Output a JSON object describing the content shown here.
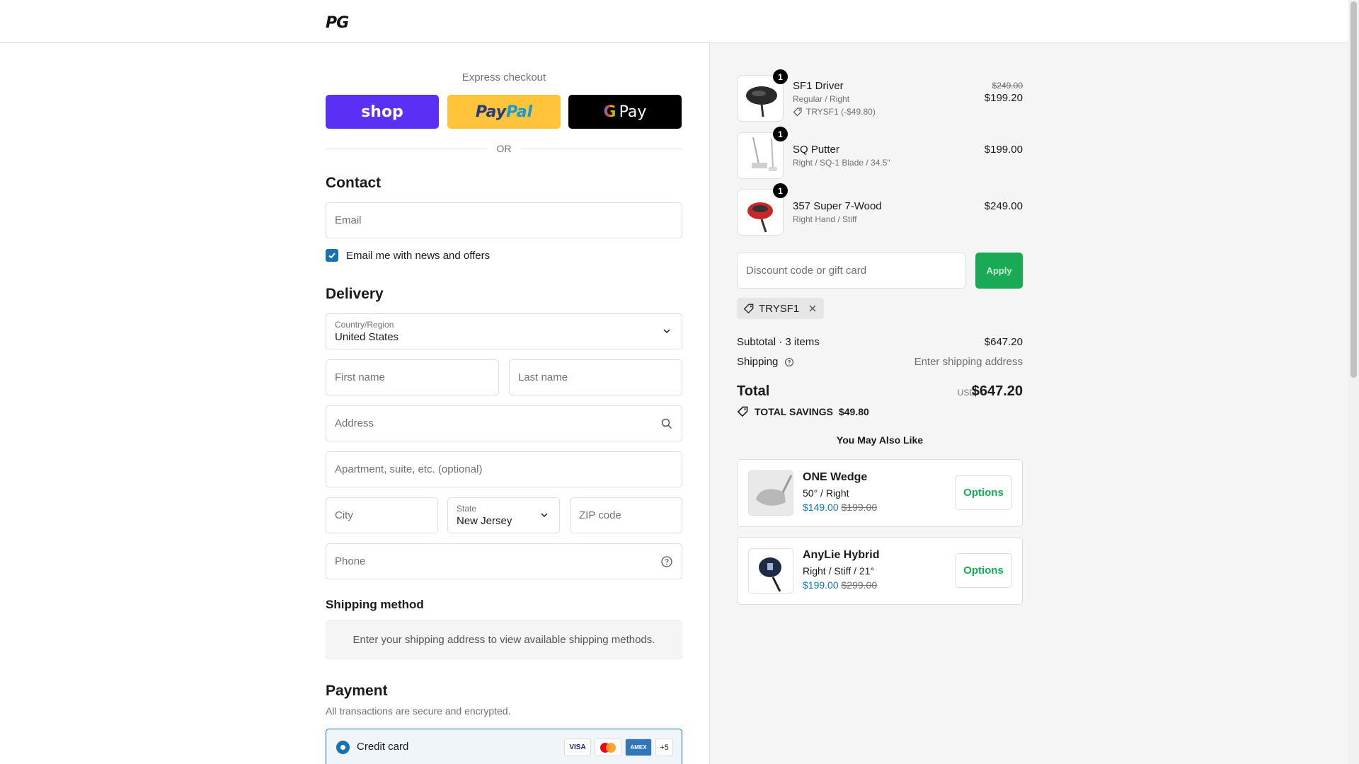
{
  "header": {
    "logo": "PG"
  },
  "express": {
    "title": "Express checkout",
    "buttons": [
      {
        "name": "shop",
        "label": "shop"
      },
      {
        "name": "paypal",
        "label_a": "Pay",
        "label_b": "Pal"
      },
      {
        "name": "gpay",
        "label_g": "G",
        "label": "Pay"
      }
    ],
    "or": "OR"
  },
  "contact": {
    "heading": "Contact",
    "email_placeholder": "Email",
    "newsletter_label": "Email me with news and offers",
    "newsletter_checked": true
  },
  "delivery": {
    "heading": "Delivery",
    "country_label": "Country/Region",
    "country_value": "United States",
    "first_name": "First name",
    "last_name": "Last name",
    "address": "Address",
    "apartment": "Apartment, suite, etc. (optional)",
    "city": "City",
    "state_label": "State",
    "state_value": "New Jersey",
    "zip": "ZIP code",
    "phone": "Phone"
  },
  "shipping_method": {
    "heading": "Shipping method",
    "message": "Enter your shipping address to view available shipping methods."
  },
  "payment": {
    "heading": "Payment",
    "subtitle": "All transactions are secure and encrypted.",
    "method_label": "Credit card",
    "cards": [
      "VISA",
      "MC",
      "AMEX",
      "+5"
    ]
  },
  "cart": {
    "items": [
      {
        "qty": "1",
        "name": "SF1 Driver",
        "variant": "Regular / Right",
        "discount": "TRYSF1 (-$49.80)",
        "original_price": "$249.00",
        "price": "$199.20"
      },
      {
        "qty": "1",
        "name": "SQ Putter",
        "variant": "Right / SQ-1 Blade / 34.5\"",
        "price": "$199.00"
      },
      {
        "qty": "1",
        "name": "357 Super 7-Wood",
        "variant": "Right Hand / Stiff",
        "price": "$249.00"
      }
    ],
    "discount_placeholder": "Discount code or gift card",
    "apply_label": "Apply",
    "applied_code": "TRYSF1",
    "subtotal_label": "Subtotal · 3 items",
    "subtotal_value": "$647.20",
    "shipping_label": "Shipping",
    "shipping_value": "Enter shipping address",
    "total_label": "Total",
    "currency": "USD",
    "total_value": "$647.20",
    "savings_label": "TOTAL SAVINGS",
    "savings_value": "$49.80"
  },
  "recommendations": {
    "heading": "You May Also Like",
    "items": [
      {
        "name": "ONE Wedge",
        "variant": "50° / Right",
        "price": "$149.00",
        "compare_price": "$199.00",
        "button": "Options"
      },
      {
        "name": "AnyLie Hybrid",
        "variant": "Right / Stiff / 21°",
        "price": "$199.00",
        "compare_price": "$299.00",
        "button": "Options"
      }
    ]
  },
  "colors": {
    "accent_blue": "#1773b0",
    "apply_green": "#1aaa55",
    "shop_purple": "#5a31f4",
    "paypal_yellow": "#ffc439"
  }
}
